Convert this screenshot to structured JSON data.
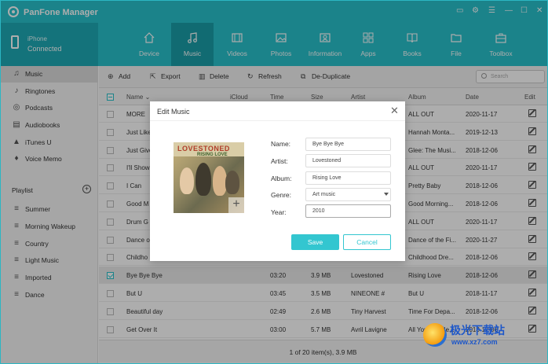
{
  "app": {
    "title": "PanFone Manager"
  },
  "device": {
    "name": "iPhone",
    "status": "Connected"
  },
  "nav": [
    {
      "label": "Device",
      "icon": "home-icon"
    },
    {
      "label": "Music",
      "icon": "music-icon"
    },
    {
      "label": "Videos",
      "icon": "film-icon"
    },
    {
      "label": "Photos",
      "icon": "image-icon"
    },
    {
      "label": "Information",
      "icon": "contact-card-icon"
    },
    {
      "label": "Apps",
      "icon": "apps-grid-icon"
    },
    {
      "label": "Books",
      "icon": "book-icon"
    },
    {
      "label": "File",
      "icon": "folder-icon"
    },
    {
      "label": "Toolbox",
      "icon": "toolbox-icon"
    }
  ],
  "sidebar": {
    "items": [
      {
        "label": "Music",
        "icon": "♫"
      },
      {
        "label": "Ringtones",
        "icon": "♪"
      },
      {
        "label": "Podcasts",
        "icon": "◎"
      },
      {
        "label": "Audiobooks",
        "icon": "▤"
      },
      {
        "label": "iTunes U",
        "icon": "▲"
      },
      {
        "label": "Voice Memo",
        "icon": "♦"
      }
    ],
    "playlist_title": "Playlist",
    "playlist_add": "+",
    "playlists": [
      "Summer",
      "Morning Wakeup",
      "Country",
      "Light Music",
      "Imported",
      "Dance"
    ]
  },
  "toolbar": {
    "add": "Add",
    "export": "Export",
    "delete": "Delete",
    "refresh": "Refresh",
    "dedup": "De-Duplicate",
    "search_placeholder": "Search"
  },
  "table": {
    "headers": {
      "name": "Name",
      "icloud": "iCloud",
      "time": "Time",
      "size": "Size",
      "artist": "Artist",
      "album": "Album",
      "date": "Date",
      "edit": "Edit"
    },
    "rows": [
      {
        "name": "MORE",
        "time": "",
        "size": "",
        "artist": "",
        "album": "ALL OUT",
        "date": "2020-11-17",
        "checked": false
      },
      {
        "name": "Just Like",
        "time": "",
        "size": "",
        "artist": "",
        "album": "Hannah Monta...",
        "date": "2019-12-13",
        "checked": false
      },
      {
        "name": "Just Give",
        "time": "",
        "size": "",
        "artist": "",
        "album": "Glee: The Musi...",
        "date": "2018-12-06",
        "checked": false
      },
      {
        "name": "I'll Show",
        "time": "",
        "size": "",
        "artist": "",
        "album": "ALL OUT",
        "date": "2020-11-17",
        "checked": false
      },
      {
        "name": "I Can",
        "time": "",
        "size": "",
        "artist": "",
        "album": "Pretty Baby",
        "date": "2018-12-06",
        "checked": false
      },
      {
        "name": "Good M",
        "time": "",
        "size": "",
        "artist": "",
        "album": "Good Morning...",
        "date": "2018-12-06",
        "checked": false
      },
      {
        "name": "Drum G",
        "time": "",
        "size": "",
        "artist": "",
        "album": "ALL OUT",
        "date": "2020-11-17",
        "checked": false
      },
      {
        "name": "Dance o",
        "time": "",
        "size": "",
        "artist": "",
        "album": "Dance of the Fi...",
        "date": "2020-11-27",
        "checked": false
      },
      {
        "name": "Childho",
        "time": "",
        "size": "",
        "artist": "",
        "album": "Childhood Dre...",
        "date": "2018-12-06",
        "checked": false
      },
      {
        "name": "Bye Bye Bye",
        "time": "03:20",
        "size": "3.9 MB",
        "artist": "Lovestoned",
        "album": "Rising Love",
        "date": "2018-12-06",
        "checked": true
      },
      {
        "name": "But U",
        "time": "03:45",
        "size": "3.5 MB",
        "artist": "NINEONE #",
        "album": "But U",
        "date": "2018-11-17",
        "checked": false
      },
      {
        "name": "Beautiful day",
        "time": "02:49",
        "size": "2.6 MB",
        "artist": "Tiny Harvest",
        "album": "Time For Depa...",
        "date": "2018-12-06",
        "checked": false
      },
      {
        "name": "Get Over It",
        "time": "03:00",
        "size": "5.7 MB",
        "artist": "Avril Lavigne",
        "album": "All You Will Ne...",
        "date": "2018-12-06",
        "checked": false
      }
    ]
  },
  "status": "1 of 20 item(s), 3.9 MB",
  "dialog": {
    "title": "Edit Music",
    "close": "✕",
    "cover_title": "LOVESTONED",
    "cover_sub": "RISING LOVE",
    "cover_add": "+",
    "labels": {
      "name": "Name:",
      "artist": "Artist:",
      "album": "Album:",
      "genre": "Genre:",
      "year": "Year:"
    },
    "values": {
      "name": "Bye Bye Bye",
      "artist": "Lovestoned",
      "album": "Rising Love",
      "genre": "Art music",
      "year": "2010"
    },
    "save": "Save",
    "cancel": "Cancel"
  },
  "watermark": {
    "line1": "极光下载站",
    "line2": "www.xz7.com"
  },
  "colors": {
    "accent": "#29c1cc",
    "accent_dark": "#1a9ea8",
    "button": "#33c6d0",
    "watermark": "#1d57c9"
  }
}
